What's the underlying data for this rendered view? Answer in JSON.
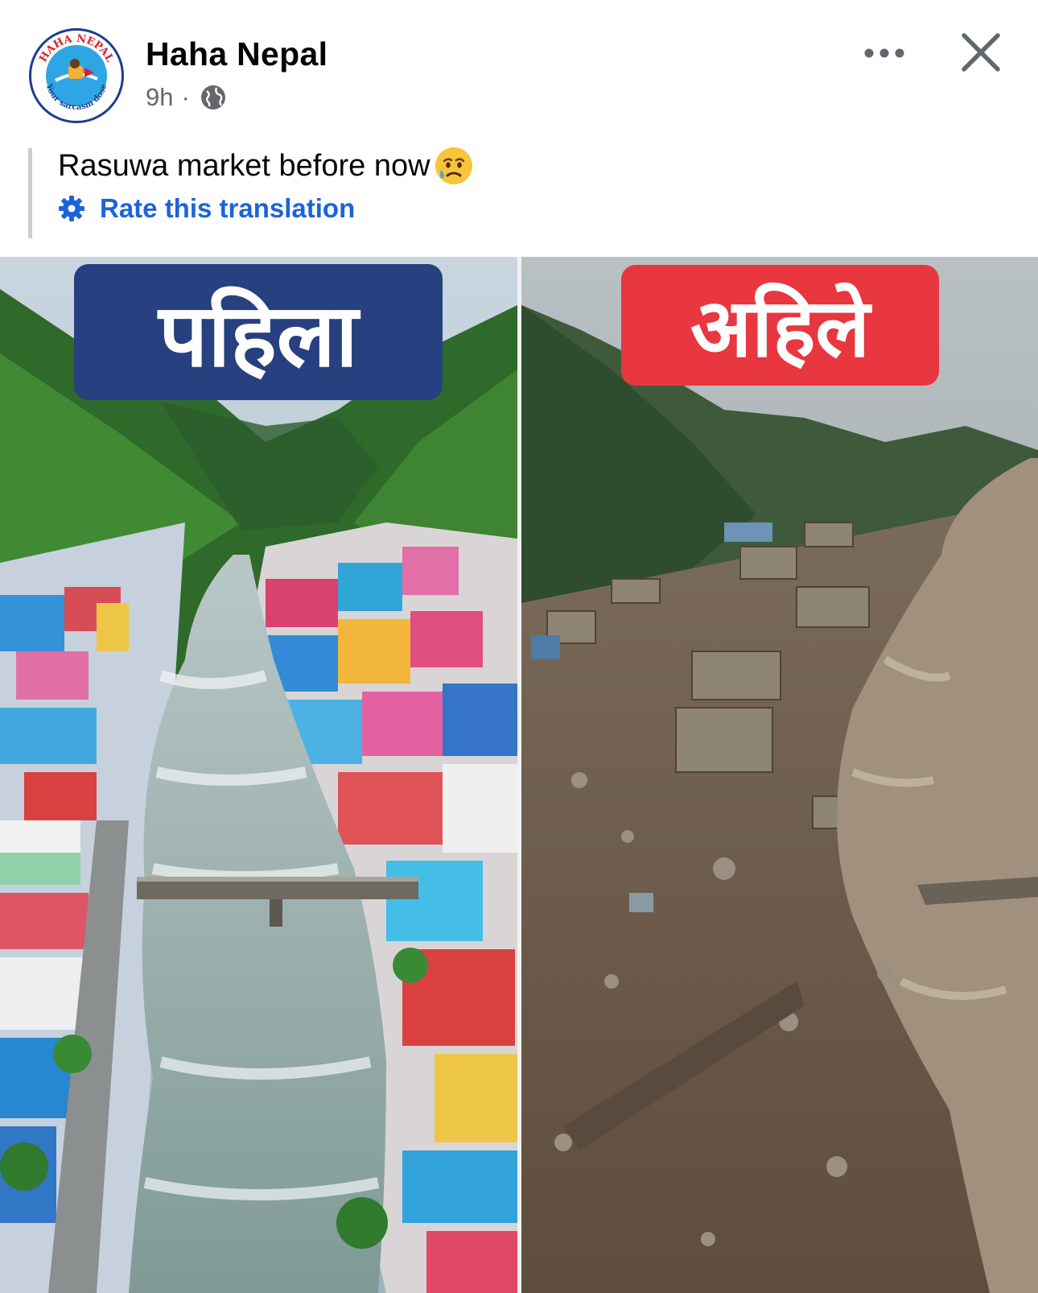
{
  "post": {
    "page_name": "Haha Nepal",
    "time": "9h",
    "separator": "·",
    "privacy_icon": "globe-icon",
    "caption": "Rasuwa market before now",
    "caption_emoji": "sad-relieved-face-emoji",
    "translation_link": "Rate this translation",
    "translation_icon": "gear-icon"
  },
  "avatar": {
    "logo_text_top": "HAHA NEPAL",
    "logo_text_bottom": "Your sarcasm dose"
  },
  "actions": {
    "more_icon": "more-options-icon",
    "close_icon": "close-icon"
  },
  "image": {
    "label_before": "पहिला",
    "label_now": "अहिले"
  },
  "colors": {
    "link_blue": "#1b64d8",
    "before_label_bg": "#27407f",
    "now_label_bg": "#e8373f",
    "secondary_text": "#65676b"
  }
}
